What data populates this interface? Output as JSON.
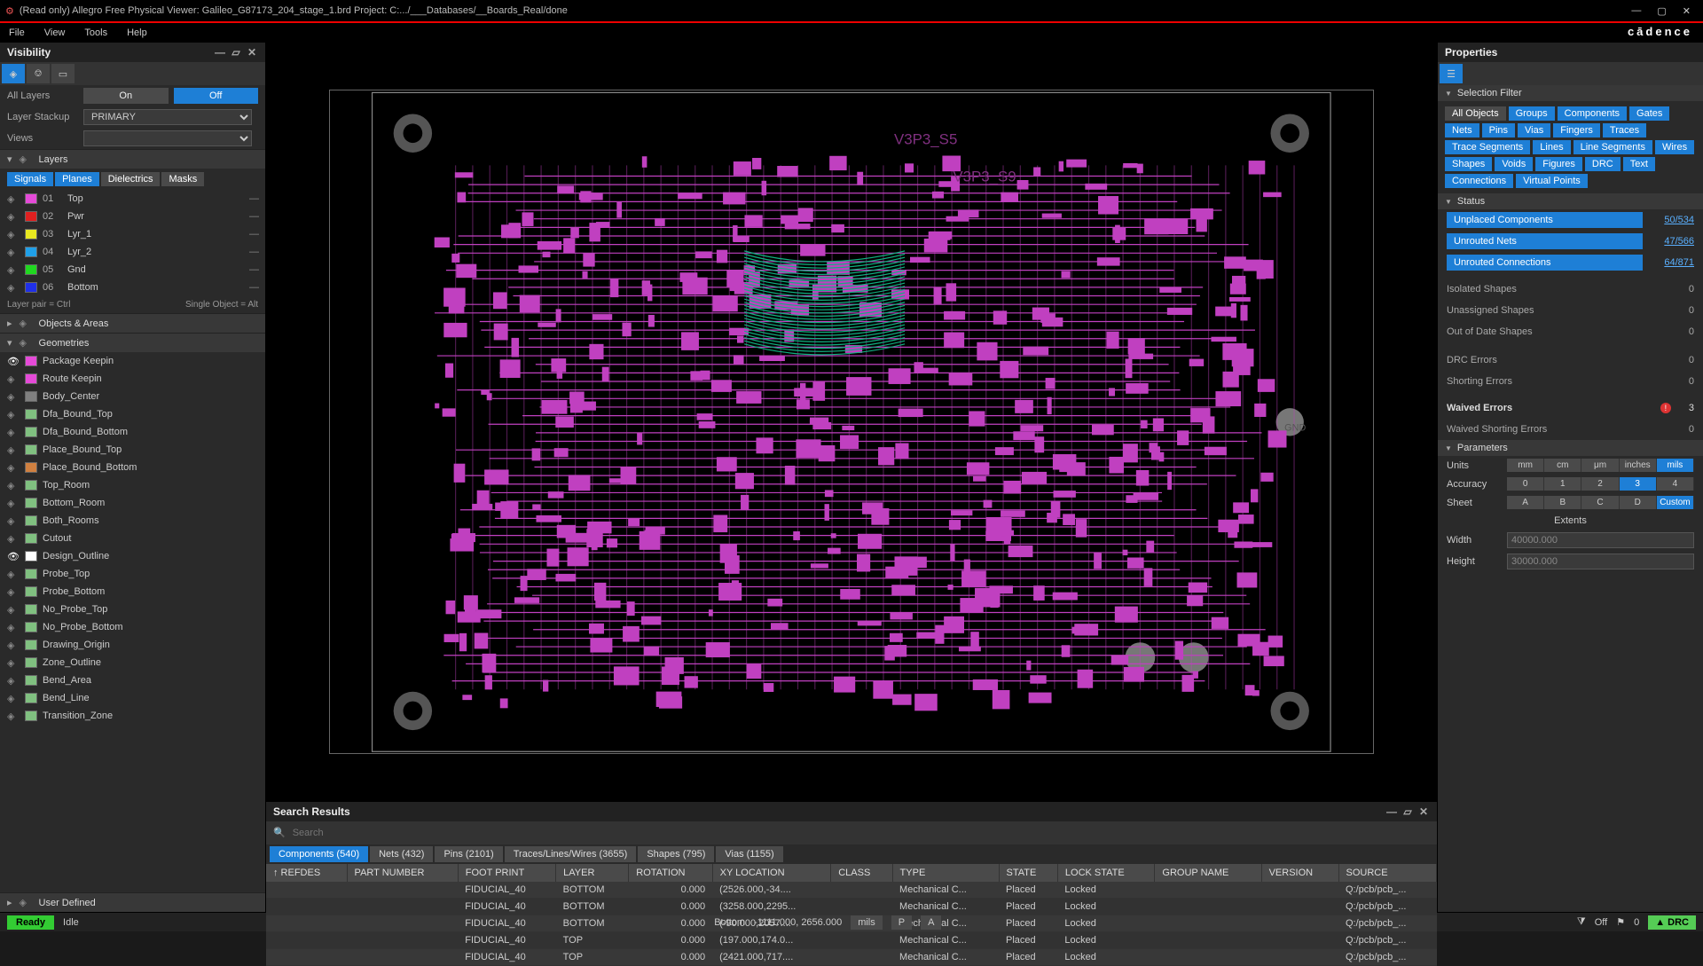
{
  "title": "(Read only) Allegro Free Physical Viewer: Galileo_G87173_204_stage_1.brd   Project: C:.../___Databases/__Boards_Real/done",
  "menus": [
    "File",
    "View",
    "Tools",
    "Help"
  ],
  "brand": "cādence",
  "visibility": {
    "title": "Visibility",
    "allLayers": "All Layers",
    "on": "On",
    "off": "Off",
    "layerStackup": "Layer Stackup",
    "layerStackupValue": "PRIMARY",
    "views": "Views",
    "layersHeader": "Layers",
    "layerTabs": [
      "Signals",
      "Planes",
      "Dielectrics",
      "Masks"
    ],
    "layers": [
      {
        "n": "01",
        "name": "Top",
        "color": "#e54ad8"
      },
      {
        "n": "02",
        "name": "Pwr",
        "color": "#e02020"
      },
      {
        "n": "03",
        "name": "Lyr_1",
        "color": "#e8e820"
      },
      {
        "n": "04",
        "name": "Lyr_2",
        "color": "#20a0e8"
      },
      {
        "n": "05",
        "name": "Gnd",
        "color": "#20d820"
      },
      {
        "n": "06",
        "name": "Bottom",
        "color": "#2030e8"
      }
    ],
    "hintLeft": "Layer pair = Ctrl",
    "hintRight": "Single Object = Alt",
    "objectsHeader": "Objects & Areas",
    "geometriesHeader": "Geometries",
    "geometries": [
      {
        "name": "Package Keepin",
        "color": "#e54ad8",
        "on": true
      },
      {
        "name": "Route Keepin",
        "color": "#e54ad8",
        "on": false
      },
      {
        "name": "Body_Center",
        "color": "#808080",
        "on": false
      },
      {
        "name": "Dfa_Bound_Top",
        "color": "#80c080",
        "on": false
      },
      {
        "name": "Dfa_Bound_Bottom",
        "color": "#80c080",
        "on": false
      },
      {
        "name": "Place_Bound_Top",
        "color": "#80c080",
        "on": false
      },
      {
        "name": "Place_Bound_Bottom",
        "color": "#d08040",
        "on": false
      },
      {
        "name": "Top_Room",
        "color": "#80c080",
        "on": false
      },
      {
        "name": "Bottom_Room",
        "color": "#80c080",
        "on": false
      },
      {
        "name": "Both_Rooms",
        "color": "#80c080",
        "on": false
      },
      {
        "name": "Cutout",
        "color": "#80c080",
        "on": false
      },
      {
        "name": "Design_Outline",
        "color": "#ffffff",
        "on": true
      },
      {
        "name": "Probe_Top",
        "color": "#80c080",
        "on": false
      },
      {
        "name": "Probe_Bottom",
        "color": "#80c080",
        "on": false
      },
      {
        "name": "No_Probe_Top",
        "color": "#80c080",
        "on": false
      },
      {
        "name": "No_Probe_Bottom",
        "color": "#80c080",
        "on": false
      },
      {
        "name": "Drawing_Origin",
        "color": "#80c080",
        "on": false
      },
      {
        "name": "Zone_Outline",
        "color": "#80c080",
        "on": false
      },
      {
        "name": "Bend_Area",
        "color": "#80c080",
        "on": false
      },
      {
        "name": "Bend_Line",
        "color": "#80c080",
        "on": false
      },
      {
        "name": "Transition_Zone",
        "color": "#80c080",
        "on": false
      }
    ],
    "userDefined": "User Defined"
  },
  "search": {
    "title": "Search Results",
    "placeholder": "Search",
    "tabs": [
      {
        "label": "Components (540)",
        "active": true
      },
      {
        "label": "Nets (432)",
        "active": false
      },
      {
        "label": "Pins (2101)",
        "active": false
      },
      {
        "label": "Traces/Lines/Wires (3655)",
        "active": false
      },
      {
        "label": "Shapes (795)",
        "active": false
      },
      {
        "label": "Vias (1155)",
        "active": false
      }
    ],
    "columns": [
      "REFDES",
      "PART NUMBER",
      "FOOT PRINT",
      "LAYER",
      "ROTATION",
      "XY LOCATION",
      "CLASS",
      "TYPE",
      "STATE",
      "LOCK STATE",
      "GROUP NAME",
      "VERSION",
      "SOURCE"
    ],
    "rows": [
      {
        "foot": "FIDUCIAL_40",
        "layer": "BOTTOM",
        "rot": "0.000",
        "xy": "(2526.000,-34....",
        "class": "",
        "type": "Mechanical C...",
        "state": "Placed",
        "lock": "Locked",
        "src": "Q:/pcb/pcb_..."
      },
      {
        "foot": "FIDUCIAL_40",
        "layer": "BOTTOM",
        "rot": "0.000",
        "xy": "(3258.000,2295...",
        "class": "",
        "type": "Mechanical C...",
        "state": "Placed",
        "lock": "Locked",
        "src": "Q:/pcb/pcb_..."
      },
      {
        "foot": "FIDUCIAL_40",
        "layer": "BOTTOM",
        "rot": "0.000",
        "xy": "(-90.000,2057....",
        "class": "",
        "type": "Mechanical C...",
        "state": "Placed",
        "lock": "Locked",
        "src": "Q:/pcb/pcb_..."
      },
      {
        "foot": "FIDUCIAL_40",
        "layer": "TOP",
        "rot": "0.000",
        "xy": "(197.000,174.0...",
        "class": "",
        "type": "Mechanical C...",
        "state": "Placed",
        "lock": "Locked",
        "src": "Q:/pcb/pcb_..."
      },
      {
        "foot": "FIDUCIAL_40",
        "layer": "TOP",
        "rot": "0.000",
        "xy": "(2421.000,717....",
        "class": "",
        "type": "Mechanical C...",
        "state": "Placed",
        "lock": "Locked",
        "src": "Q:/pcb/pcb_..."
      }
    ]
  },
  "properties": {
    "title": "Properties",
    "selFilter": "Selection Filter",
    "filterChips": [
      "All Objects",
      "Groups",
      "Components",
      "Gates",
      "Nets",
      "Pins",
      "Vias",
      "Fingers",
      "Traces",
      "Trace Segments",
      "Lines",
      "Line Segments",
      "Wires",
      "Shapes",
      "Voids",
      "Figures",
      "DRC",
      "Text",
      "Connections",
      "Virtual Points"
    ],
    "statusHeader": "Status",
    "statusBars": [
      {
        "label": "Unplaced Components",
        "value": "50/534"
      },
      {
        "label": "Unrouted Nets",
        "value": "47/566"
      },
      {
        "label": "Unrouted Connections",
        "value": "64/871"
      }
    ],
    "statusPlain": [
      {
        "label": "Isolated Shapes",
        "value": "0"
      },
      {
        "label": "Unassigned Shapes",
        "value": "0"
      },
      {
        "label": "Out of Date Shapes",
        "value": "0"
      },
      {
        "label": "DRC Errors",
        "value": "0"
      },
      {
        "label": "Shorting Errors",
        "value": "0"
      }
    ],
    "waivedErrors": {
      "label": "Waived Errors",
      "value": "3"
    },
    "waivedShorting": {
      "label": "Waived Shorting Errors",
      "value": "0"
    },
    "paramsHeader": "Parameters",
    "units": {
      "label": "Units",
      "opts": [
        "mm",
        "cm",
        "μm",
        "inches",
        "mils"
      ],
      "active": 4
    },
    "accuracy": {
      "label": "Accuracy",
      "opts": [
        "0",
        "1",
        "2",
        "3",
        "4"
      ],
      "active": 3
    },
    "sheet": {
      "label": "Sheet",
      "opts": [
        "A",
        "B",
        "C",
        "D",
        "Custom"
      ],
      "active": 4
    },
    "extents": "Extents",
    "width": {
      "label": "Width",
      "value": "40000.000"
    },
    "height": {
      "label": "Height",
      "value": "30000.000"
    }
  },
  "statusBar": {
    "ready": "Ready",
    "idle": "Idle",
    "layer": "Bottom",
    "coord": "-1111.000, 2656.000",
    "unit": "mils",
    "p": "P",
    "a": "A",
    "off": "Off",
    "zero": "0",
    "drc": "DRC"
  },
  "canvas": {
    "net1": "V3P3_S5",
    "net2": "V3P3_S9",
    "gnd": "GND"
  }
}
